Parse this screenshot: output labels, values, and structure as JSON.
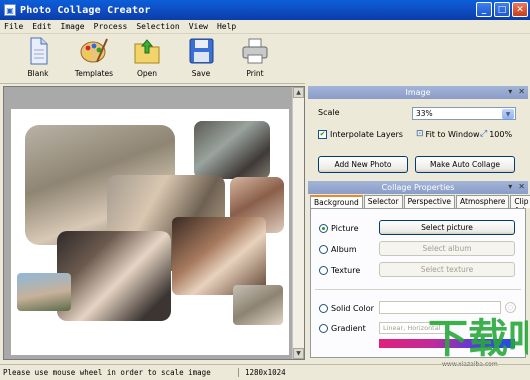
{
  "window": {
    "title": "Photo Collage Creator",
    "min": "_",
    "max": "□",
    "close": "✕"
  },
  "menu": [
    "File",
    "Edit",
    "Image",
    "Process",
    "Selection",
    "View",
    "Help"
  ],
  "toolbar": [
    {
      "label": "Blank",
      "icon": "blank-page-icon"
    },
    {
      "label": "Templates",
      "icon": "palette-icon"
    },
    {
      "label": "Open",
      "icon": "open-folder-icon"
    },
    {
      "label": "Save",
      "icon": "floppy-disk-icon"
    },
    {
      "label": "Print",
      "icon": "printer-icon"
    }
  ],
  "image_panel": {
    "title": "Image",
    "scale_label": "Scale",
    "scale_value": "33%",
    "interpolate_label": "Interpolate Layers",
    "interpolate_checked": true,
    "fit_label": "Fit to Window",
    "hundred_label": "100%",
    "add_photo": "Add New Photo",
    "auto_collage": "Make Auto Collage"
  },
  "collage_panel": {
    "title": "Collage Properties",
    "tabs": [
      "Background",
      "Selector",
      "Perspective",
      "Atmosphere",
      "Clip Art"
    ],
    "active_tab": "Background",
    "picture_label": "Picture",
    "select_picture": "Select picture",
    "album_label": "Album",
    "select_album": "Select album",
    "texture_label": "Texture",
    "select_texture": "Select texture",
    "solid_label": "Solid Color",
    "gradient_label": "Gradient",
    "gradient_value": "Linear, Horizontal"
  },
  "status": {
    "message": "Please use mouse wheel in order to scale image",
    "dimensions": "1280x1024"
  },
  "watermark": {
    "text": "www.xiazaiba.com"
  }
}
